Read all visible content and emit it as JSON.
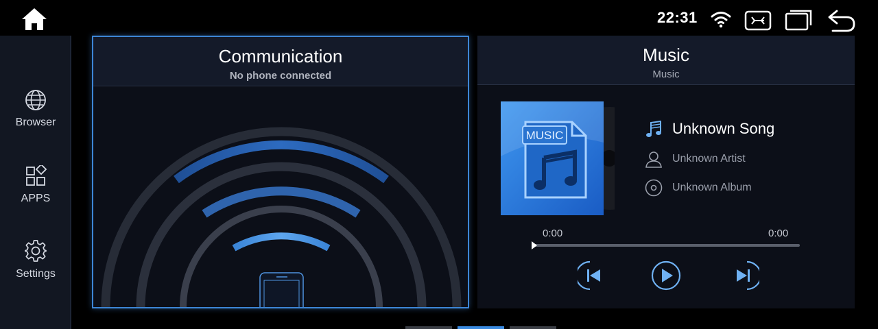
{
  "status_bar": {
    "time": "22:31",
    "icons": [
      "home-icon",
      "wifi-icon",
      "close-box-icon",
      "recent-windows-icon",
      "back-icon"
    ]
  },
  "sidebar": {
    "items": [
      {
        "label": "Browser",
        "icon": "globe-icon"
      },
      {
        "label": "APPS",
        "icon": "apps-grid-icon"
      },
      {
        "label": "Settings",
        "icon": "gear-icon"
      }
    ]
  },
  "communication": {
    "title": "Communication",
    "subtitle": "No phone connected",
    "icon": "phone-icon"
  },
  "music": {
    "title": "Music",
    "subtitle": "Music",
    "album_art_label": "MUSIC",
    "song": "Unknown Song",
    "artist": "Unknown Artist",
    "album": "Unknown Album",
    "elapsed": "0:00",
    "duration": "0:00",
    "progress": 0
  },
  "pager": {
    "count": 3,
    "active_index": 1
  },
  "colors": {
    "accent": "#3d86d6",
    "panel_bg": "#0c0f18",
    "header_bg": "#141a29",
    "sidebar_bg": "#121722",
    "pager_active": "#3a8ae0",
    "pager_inactive": "#3a3d44"
  }
}
